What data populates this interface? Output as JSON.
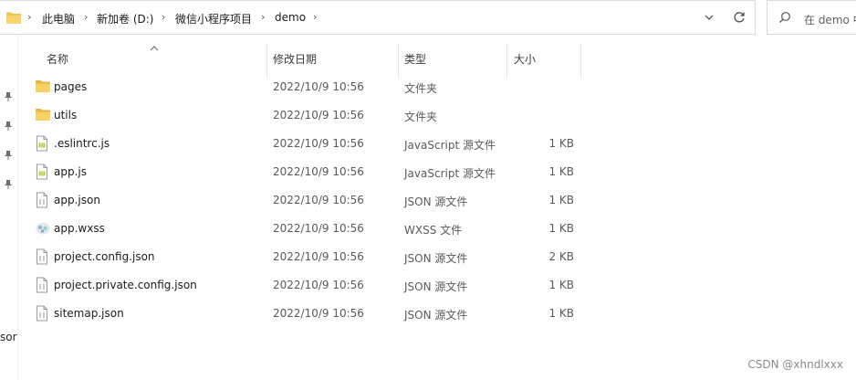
{
  "address_bar": {
    "breadcrumbs": [
      "此电脑",
      "新加卷 (D:)",
      "微信小程序项目",
      "demo"
    ]
  },
  "search": {
    "placeholder": "在 demo 中"
  },
  "columns": {
    "name": "名称",
    "date": "修改日期",
    "type": "类型",
    "size": "大小"
  },
  "files": [
    {
      "name": "pages",
      "date": "2022/10/9 10:56",
      "type": "文件夹",
      "size": "",
      "icon": "folder-icon"
    },
    {
      "name": "utils",
      "date": "2022/10/9 10:56",
      "type": "文件夹",
      "size": "",
      "icon": "folder-icon"
    },
    {
      "name": ".eslintrc.js",
      "date": "2022/10/9 10:56",
      "type": "JavaScript 源文件",
      "size": "1 KB",
      "icon": "js-file-icon"
    },
    {
      "name": "app.js",
      "date": "2022/10/9 10:56",
      "type": "JavaScript 源文件",
      "size": "1 KB",
      "icon": "js-file-icon"
    },
    {
      "name": "app.json",
      "date": "2022/10/9 10:56",
      "type": "JSON 源文件",
      "size": "1 KB",
      "icon": "json-file-icon"
    },
    {
      "name": "app.wxss",
      "date": "2022/10/9 10:56",
      "type": "WXSS 文件",
      "size": "1 KB",
      "icon": "wxss-file-icon"
    },
    {
      "name": "project.config.json",
      "date": "2022/10/9 10:56",
      "type": "JSON 源文件",
      "size": "2 KB",
      "icon": "json-file-icon"
    },
    {
      "name": "project.private.config.json",
      "date": "2022/10/9 10:56",
      "type": "JSON 源文件",
      "size": "1 KB",
      "icon": "json-file-icon"
    },
    {
      "name": "sitemap.json",
      "date": "2022/10/9 10:56",
      "type": "JSON 源文件",
      "size": "1 KB",
      "icon": "json-file-icon"
    }
  ],
  "left_nav": {
    "truncated_label": "sor"
  },
  "watermark": "CSDN @xhndlxxx",
  "colors": {
    "folder": "#f2c14e",
    "folder_dark": "#e0a72a",
    "js_badge": "#9bbf3b",
    "border": "#d9d9d9"
  }
}
